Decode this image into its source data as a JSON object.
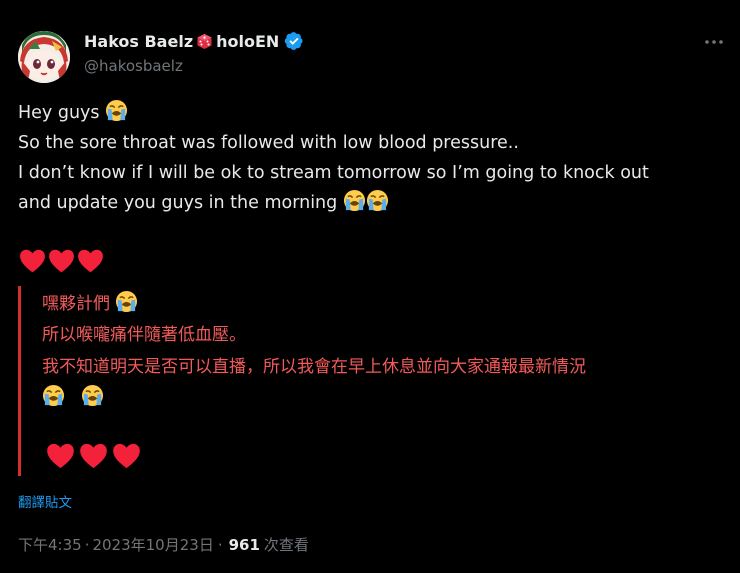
{
  "author": {
    "display_name": "Hakos Baelz",
    "affiliation": "holoEN",
    "handle": "@hakosbaelz",
    "avatar_icon": "anime-character-avatar",
    "verified_color": "#1d9bf0"
  },
  "post": {
    "lines": [
      "Hey guys",
      "So the sore throat was followed with low blood pressure..",
      "I don’t know if I will be ok to stream tomorrow so I’m going to knock out",
      "and update you guys in the morning"
    ],
    "emoji": "loudly-crying-face"
  },
  "translation": {
    "lines": [
      "嘿夥計們",
      "所以喉嚨痛伴隨著低血壓。",
      "我不知道明天是否可以直播，所以我會在早上休息並向大家通報最新情況"
    ],
    "text_color": "#f25a5a",
    "border_color": "#d32f2f"
  },
  "translate_label": "翻譯貼文",
  "meta": {
    "time": "下午4:35",
    "separator": "·",
    "date": "2023年10月23日",
    "views_count": "961",
    "views_label": "次查看"
  },
  "colors": {
    "background": "#000000",
    "text": "#e7e9ea",
    "muted": "#71767b",
    "link": "#1d9bf0",
    "heart": "#f4213b"
  }
}
